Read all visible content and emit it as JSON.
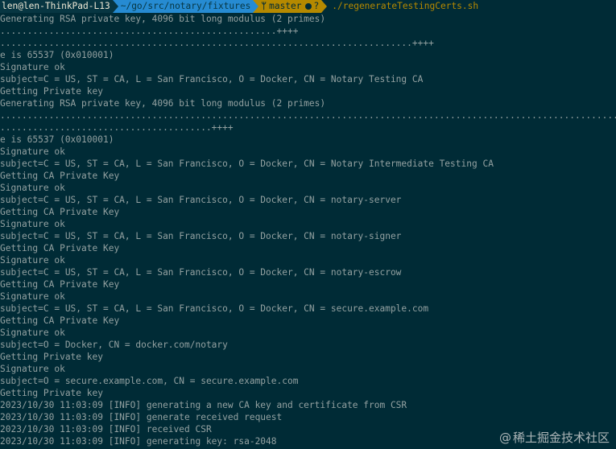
{
  "prompt": {
    "user_host": "len@len-ThinkPad-L13",
    "path": "~/go/src/notary/fixtures",
    "branch_icon": "git-branch-icon",
    "branch": "master",
    "status_mark": "?",
    "command": "./regenerateTestingCerts.sh"
  },
  "output_lines": [
    "Generating RSA private key, 4096 bit long modulus (2 primes)",
    "...................................................++++",
    "............................................................................++++",
    "e is 65537 (0x010001)",
    "Signature ok",
    "subject=C = US, ST = CA, L = San Francisco, O = Docker, CN = Notary Testing CA",
    "Getting Private key",
    "Generating RSA private key, 4096 bit long modulus (2 primes)",
    ".................................................................................................................................",
    ".......................................++++",
    "e is 65537 (0x010001)",
    "Signature ok",
    "subject=C = US, ST = CA, L = San Francisco, O = Docker, CN = Notary Intermediate Testing CA",
    "Getting CA Private Key",
    "Signature ok",
    "subject=C = US, ST = CA, L = San Francisco, O = Docker, CN = notary-server",
    "Getting CA Private Key",
    "Signature ok",
    "subject=C = US, ST = CA, L = San Francisco, O = Docker, CN = notary-signer",
    "Getting CA Private Key",
    "Signature ok",
    "subject=C = US, ST = CA, L = San Francisco, O = Docker, CN = notary-escrow",
    "Getting CA Private Key",
    "Signature ok",
    "subject=C = US, ST = CA, L = San Francisco, O = Docker, CN = secure.example.com",
    "Getting CA Private Key",
    "Signature ok",
    "subject=O = Docker, CN = docker.com/notary",
    "Getting Private key",
    "Signature ok",
    "subject=O = secure.example.com, CN = secure.example.com",
    "Getting Private key",
    "2023/10/30 11:03:09 [INFO] generating a new CA key and certificate from CSR",
    "2023/10/30 11:03:09 [INFO] generate received request",
    "2023/10/30 11:03:09 [INFO] received CSR",
    "2023/10/30 11:03:09 [INFO] generating key: rsa-2048"
  ],
  "watermark": {
    "at": "@",
    "text": "稀土掘金技术社区"
  },
  "colors": {
    "background": "#002b36",
    "text": "#93a1a1",
    "user_segment": "#073642",
    "path_segment": "#268bd2",
    "git_segment": "#b58900",
    "command": "#b58900"
  }
}
